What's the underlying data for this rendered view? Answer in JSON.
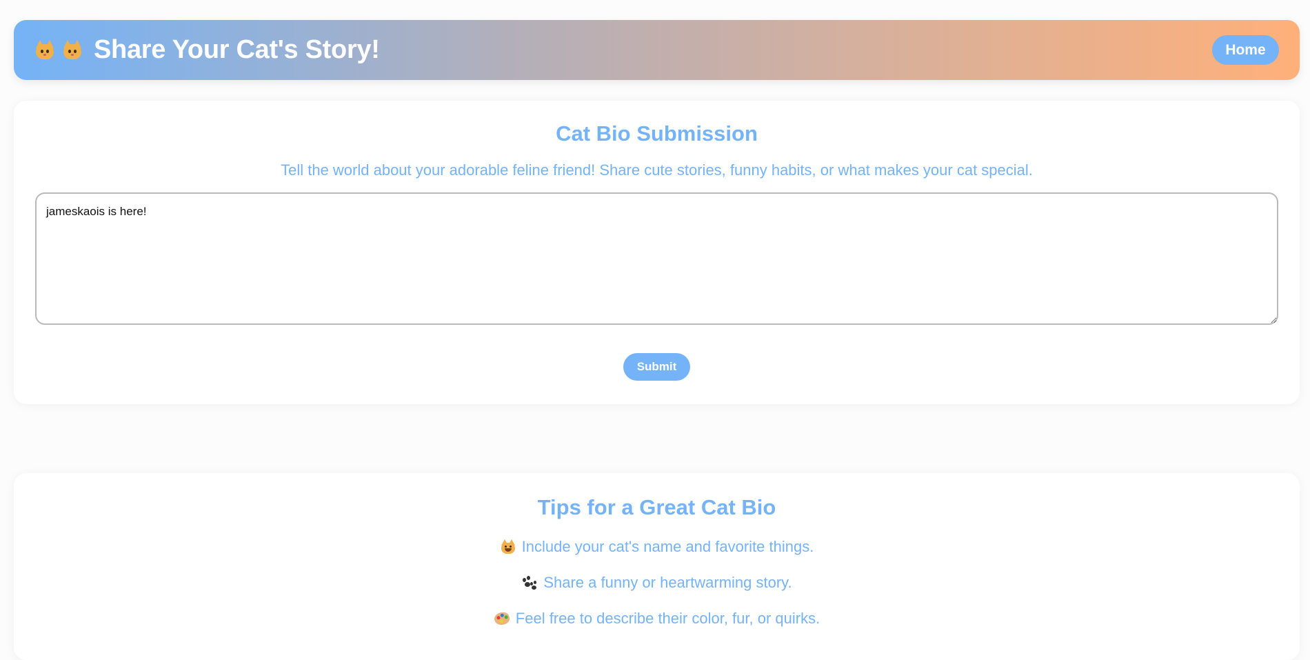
{
  "header": {
    "title": "Share Your Cat's Story!",
    "home_label": "Home",
    "icons": [
      "cat-face-icon",
      "cat-face-icon"
    ]
  },
  "submission": {
    "heading": "Cat Bio Submission",
    "description": "Tell the world about your adorable feline friend! Share cute stories, funny habits, or what makes your cat special.",
    "bio_value": "jameskaois is here!",
    "submit_label": "Submit"
  },
  "tips": {
    "heading": "Tips for a Great Cat Bio",
    "items": [
      {
        "icon": "smiling-cat-icon",
        "text": "Include your cat's name and favorite things."
      },
      {
        "icon": "paw-prints-icon",
        "text": "Share a funny or heartwarming story."
      },
      {
        "icon": "artist-palette-icon",
        "text": "Feel free to describe their color, fur, or quirks."
      }
    ]
  },
  "colors": {
    "accent": "#74b3f7",
    "gradient_start": "#74b3f7",
    "gradient_end": "#ffb07a",
    "background": "#fcfcfc"
  }
}
